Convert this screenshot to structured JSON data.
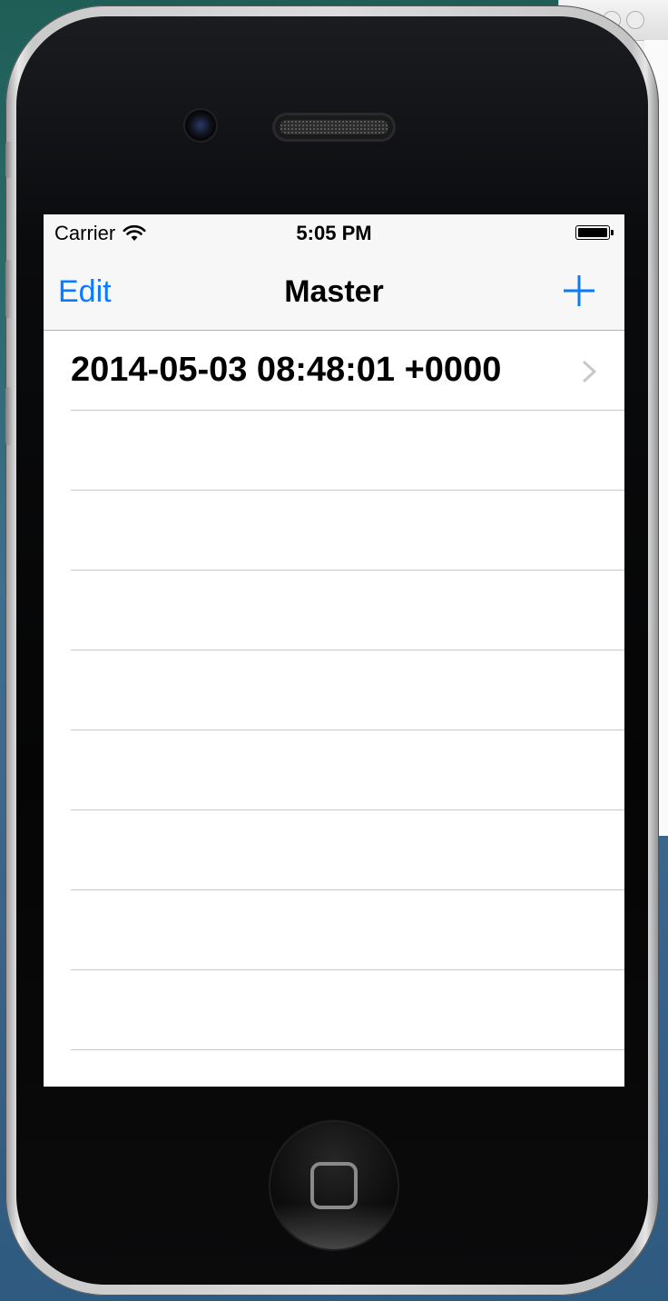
{
  "status_bar": {
    "carrier": "Carrier",
    "time": "5:05 PM",
    "wifi_icon": "wifi-icon",
    "battery_icon": "battery-icon"
  },
  "nav_bar": {
    "left_button": "Edit",
    "title": "Master",
    "right_icon": "plus-icon",
    "tint_color": "#0a7aff"
  },
  "table": {
    "rows": [
      {
        "label": "2014-05-03 08:48:01 +0000",
        "accessory": "chevron-right-icon"
      }
    ],
    "empty_row_count": 8
  }
}
